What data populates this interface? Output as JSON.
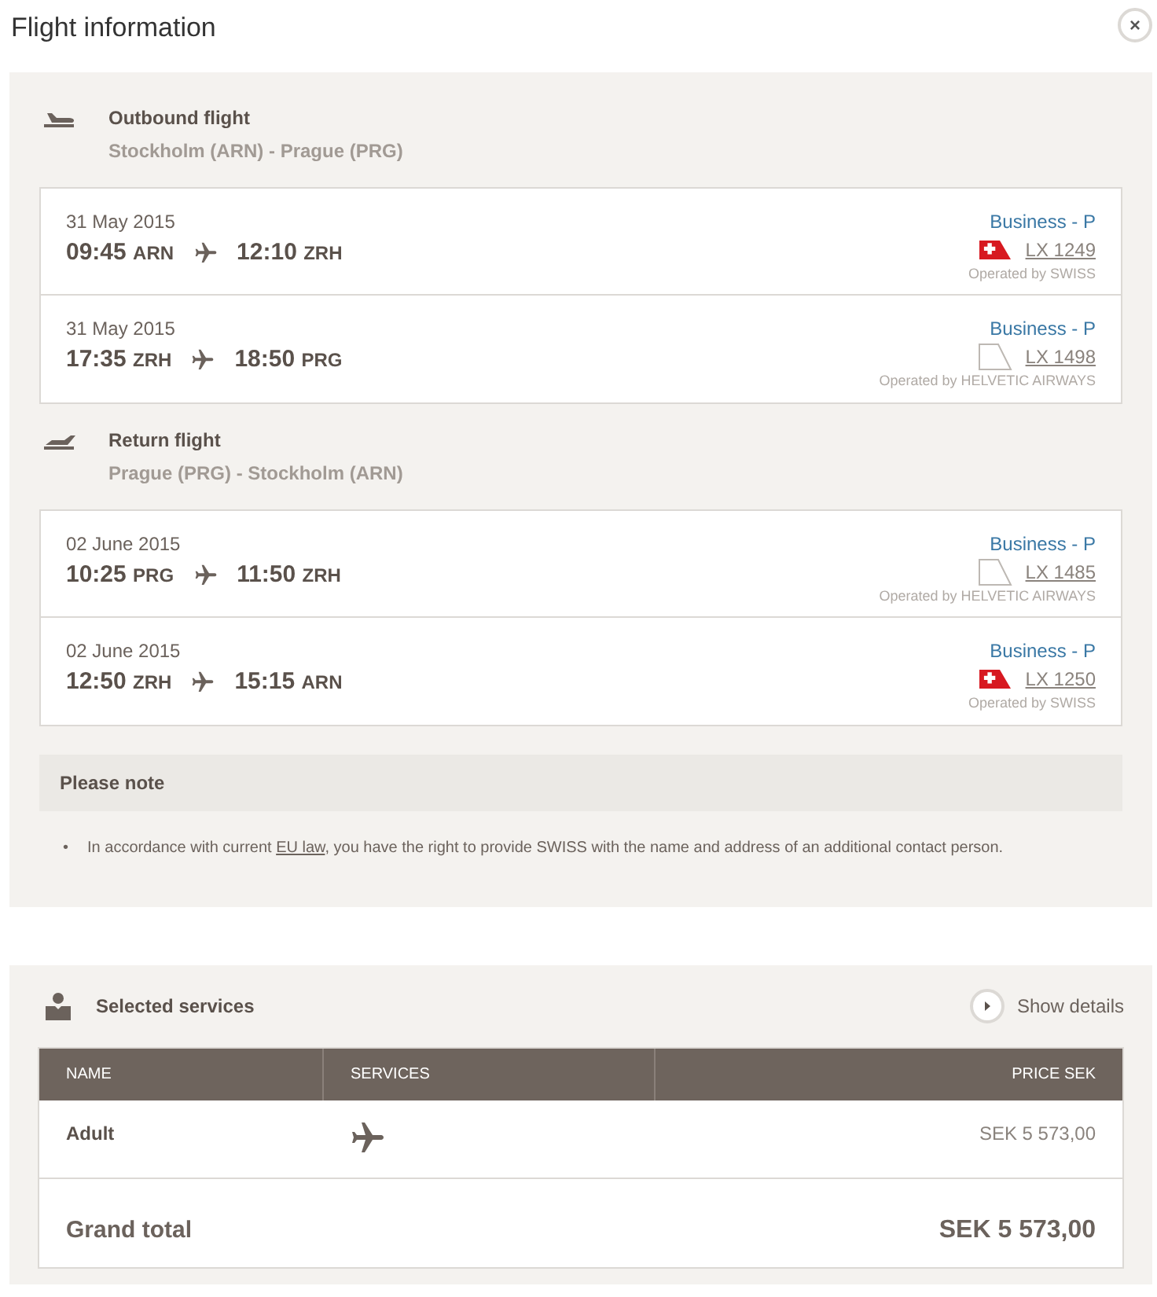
{
  "title": "Flight information",
  "close_button": "×",
  "flights": [
    {
      "kind": "departure",
      "label": "Outbound flight",
      "route": "Stockholm (ARN) - Prague (PRG)",
      "segments": [
        {
          "date": "31 May 2015",
          "dep_time": "09:45",
          "dep_code": "ARN",
          "arr_time": "12:10",
          "arr_code": "ZRH",
          "fare": "Business - P",
          "flight_no": "LX 1249",
          "logo": {
            "kind": "cross_tail"
          },
          "operator": "Operated by SWISS"
        },
        {
          "date": "31 May 2015",
          "dep_time": "17:35",
          "dep_code": "ZRH",
          "arr_time": "18:50",
          "arr_code": "PRG",
          "fare": "Business - P",
          "flight_no": "LX 1498",
          "logo": {
            "kind": "plain_tail"
          },
          "operator": "Operated by HELVETIC AIRWAYS"
        }
      ]
    },
    {
      "kind": "arrival",
      "label": "Return flight",
      "route": "Prague (PRG) - Stockholm (ARN)",
      "segments": [
        {
          "date": "02 June 2015",
          "dep_time": "10:25",
          "dep_code": "PRG",
          "arr_time": "11:50",
          "arr_code": "ZRH",
          "fare": "Business - P",
          "flight_no": "LX 1485",
          "logo": {
            "kind": "plain_tail"
          },
          "operator": "Operated by HELVETIC AIRWAYS"
        },
        {
          "date": "02 June 2015",
          "dep_time": "12:50",
          "dep_code": "ZRH",
          "arr_time": "15:15",
          "arr_code": "ARN",
          "fare": "Business - P",
          "flight_no": "LX 1250",
          "logo": {
            "kind": "cross_tail"
          },
          "operator": "Operated by SWISS"
        }
      ]
    }
  ],
  "note": {
    "heading": "Please note",
    "bullet": "•",
    "text_before": "In accordance with current",
    "link": "EU law",
    "text_after": ", you have the right to provide SWISS with the name and address of an additional contact person."
  },
  "services": {
    "title": "Selected services",
    "show_details": "Show details",
    "columns": [
      "NAME",
      "SERVICES",
      "PRICE SEK"
    ],
    "rows": [
      {
        "name": "Adult",
        "price": "SEK 5 573,00"
      }
    ],
    "total_label": "Grand total",
    "total_value": "SEK 5 573,00"
  }
}
